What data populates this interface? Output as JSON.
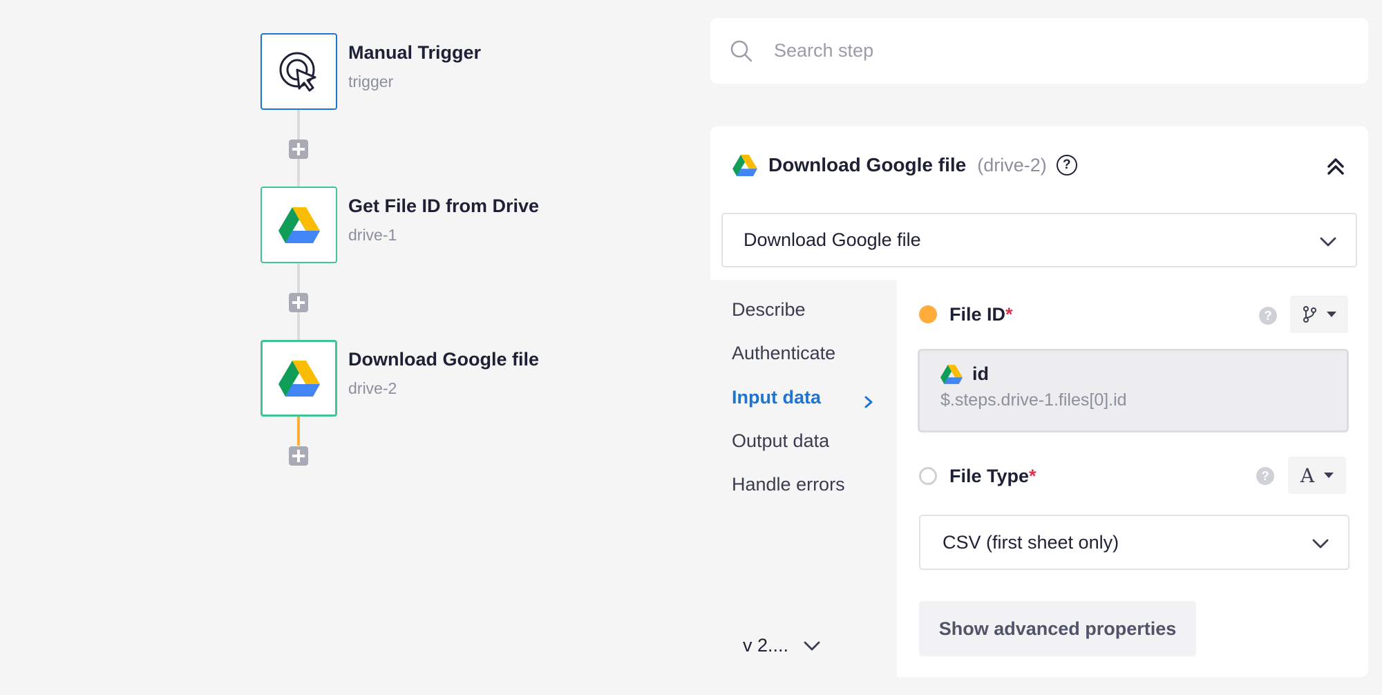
{
  "canvas": {
    "nodes": [
      {
        "title": "Manual Trigger",
        "subtitle": "trigger",
        "icon": "cursor-click-icon"
      },
      {
        "title": "Get File ID from Drive",
        "subtitle": "drive-1",
        "icon": "google-drive-icon"
      },
      {
        "title": "Download Google file",
        "subtitle": "drive-2",
        "icon": "google-drive-icon"
      }
    ]
  },
  "search": {
    "placeholder": "Search step"
  },
  "panel": {
    "title": "Download Google file",
    "ref": "(drive-2)",
    "help": "?",
    "action_select": "Download Google file",
    "sidebar": {
      "items": [
        "Describe",
        "Authenticate",
        "Input data",
        "Output data",
        "Handle errors"
      ],
      "active": "Input data",
      "version": "v 2...."
    },
    "fields": {
      "file_id": {
        "label": "File ID",
        "required_mark": "*",
        "value_name": "id",
        "value_path": "$.steps.drive-1.files[0].id"
      },
      "file_type": {
        "label": "File Type",
        "required_mark": "*",
        "type_glyph": "A",
        "selected": "CSV (first sheet only)"
      }
    },
    "advanced_button": "Show advanced properties"
  },
  "colors": {
    "accent_blue": "#1f74d1",
    "node_green": "#3fc39a",
    "active_orange": "#ffac3b",
    "required_red": "#e0334a"
  }
}
